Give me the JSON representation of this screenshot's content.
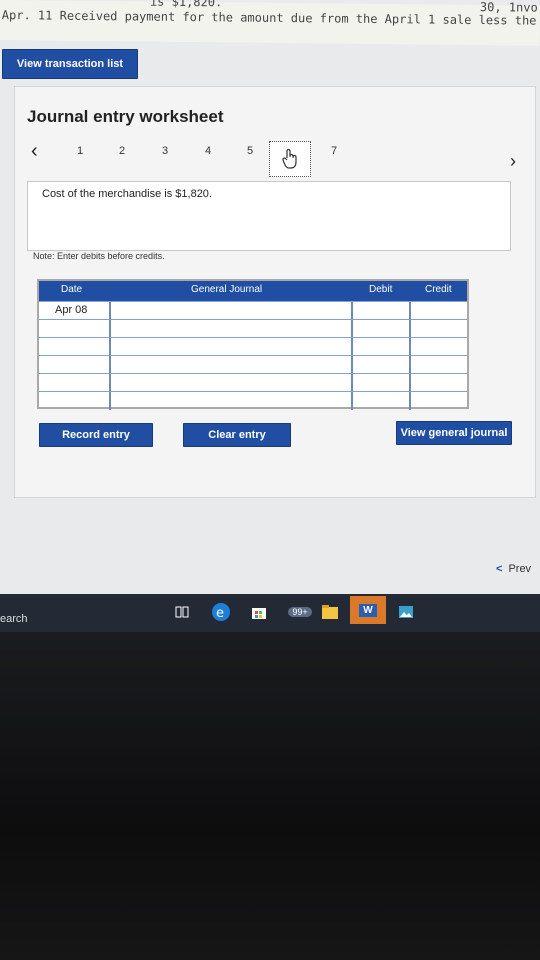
{
  "task_strip": {
    "line_cut": "is $1,820.",
    "line_main": "Apr. 11 Received payment for the amount due from the April 1 sale less the",
    "right_cut": "30, 1nvo"
  },
  "buttons": {
    "view_transaction_list": "View transaction list",
    "record_entry": "Record entry",
    "clear_entry": "Clear entry",
    "view_general_journal": "View general journal"
  },
  "worksheet": {
    "title": "Journal entry worksheet",
    "tabs": [
      "1",
      "2",
      "3",
      "4",
      "5",
      "6",
      "7"
    ],
    "active_tab": "6",
    "description": "Cost of the merchandise is $1,820.",
    "note": "Note: Enter debits before credits."
  },
  "journal_table": {
    "headers": {
      "date": "Date",
      "general_journal": "General Journal",
      "debit": "Debit",
      "credit": "Credit"
    },
    "rows": [
      {
        "date": "Apr 08",
        "account": "",
        "debit": "",
        "credit": ""
      },
      {
        "date": "",
        "account": "",
        "debit": "",
        "credit": ""
      },
      {
        "date": "",
        "account": "",
        "debit": "",
        "credit": ""
      },
      {
        "date": "",
        "account": "",
        "debit": "",
        "credit": ""
      },
      {
        "date": "",
        "account": "",
        "debit": "",
        "credit": ""
      },
      {
        "date": "",
        "account": "",
        "debit": "",
        "credit": ""
      }
    ]
  },
  "navigation": {
    "prev_label": "Prev"
  },
  "taskbar": {
    "search_text": "earch",
    "mail_badge": "99+",
    "word_icon": "W"
  },
  "colors": {
    "accent": "#1f4ea3",
    "taskbar": "#232a35"
  }
}
